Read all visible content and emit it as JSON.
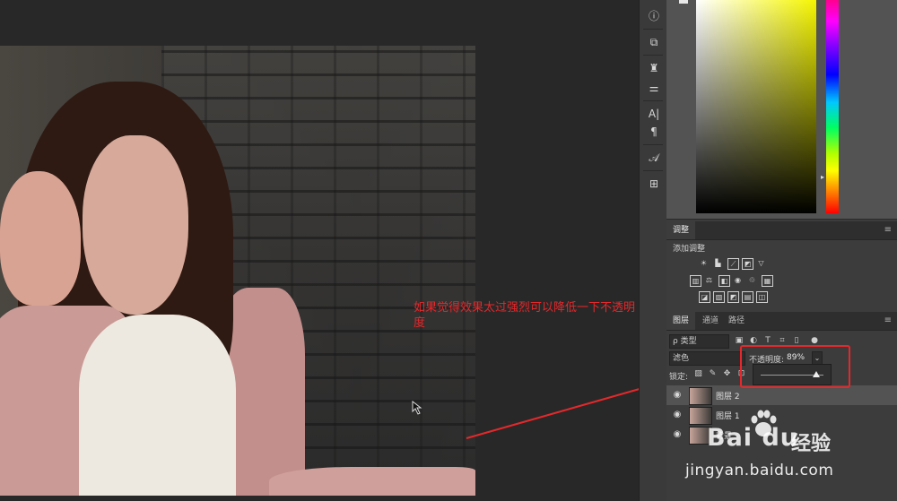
{
  "annotation": {
    "text": "如果觉得效果太过强烈可以降低一下不透明度"
  },
  "tools": {
    "icons": [
      "info-icon",
      "clone-source-icon",
      "brush-presets-icon",
      "properties-icon",
      "character-icon",
      "paragraph-icon",
      "glyphs-icon",
      "tool-presets-icon"
    ],
    "labels": [
      "ⓘ",
      "⧉",
      "♜",
      "⚌",
      "A|",
      "¶",
      "𝒜",
      "⊞"
    ]
  },
  "adjustments_panel": {
    "tab": "调整",
    "add_label": "添加调整",
    "menu": "≡"
  },
  "layers_panel": {
    "tabs": [
      "图层",
      "通道",
      "路径"
    ],
    "active_tab": "图层",
    "menu": "≡",
    "filter": {
      "value": "ρ 类型",
      "icons": [
        "image-filter-icon",
        "adjustment-filter-icon",
        "type-filter-icon",
        "shape-filter-icon",
        "smart-object-filter-icon",
        "filter-toggle-icon"
      ]
    },
    "blend_mode": "滤色",
    "opacity_label": "不透明度:",
    "opacity_value": "89%",
    "opacity_fraction": 0.89,
    "lock_label": "锁定:",
    "layers": [
      {
        "name": "图层 2",
        "selected": true
      },
      {
        "name": "图层 1",
        "selected": false
      },
      {
        "name": "背景",
        "selected": false
      }
    ]
  },
  "colors": {
    "annotation": "#e5282b",
    "panel_bg": "#3c3c3c",
    "canvas_bg": "#282828"
  },
  "watermark": {
    "brand": "Bai  du",
    "brand_cn": "经验",
    "url": "jingyan.baidu.com"
  }
}
